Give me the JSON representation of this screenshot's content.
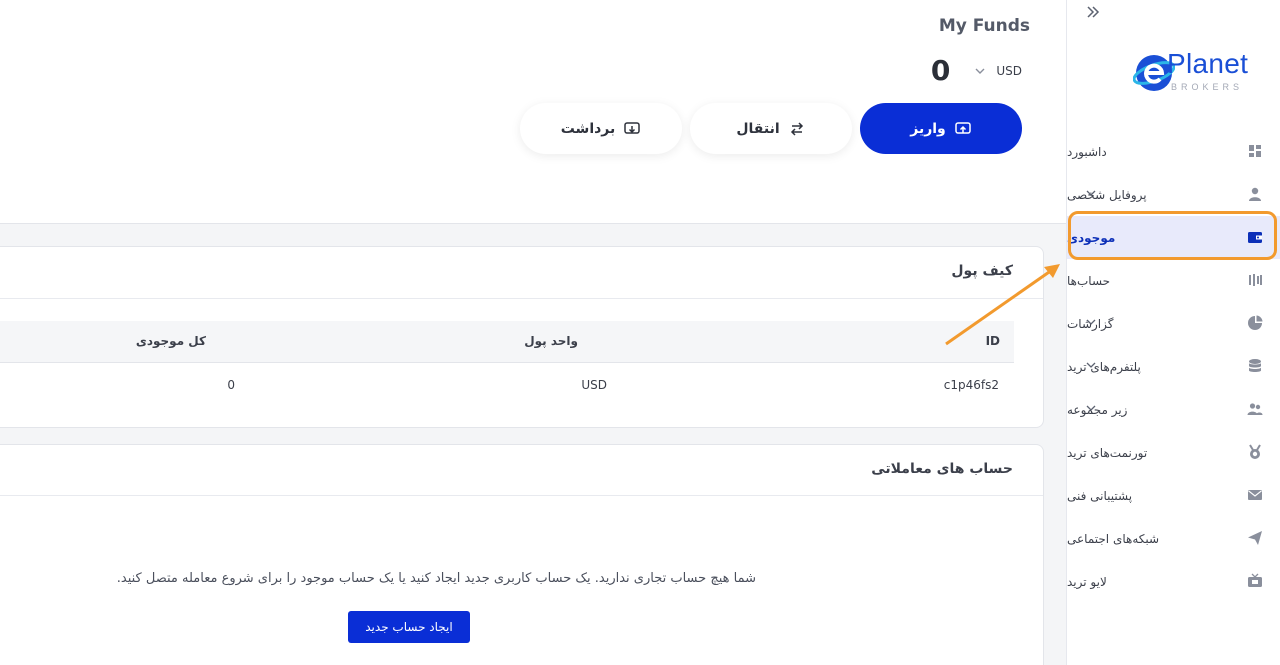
{
  "header": {
    "title": "My Funds",
    "amount": "0",
    "currency": "USD",
    "actions": {
      "deposit": "واریز",
      "transfer": "انتقال",
      "withdraw": "برداشت"
    }
  },
  "logo": {
    "name": "Planet",
    "sub": "BROKERS"
  },
  "sidebar": {
    "items": [
      {
        "label": "داشبورد",
        "icon": "dashboard-icon",
        "chevron": false,
        "active": false
      },
      {
        "label": "پروفایل شخصی",
        "icon": "user-icon",
        "chevron": true,
        "active": false
      },
      {
        "label": "موجودی",
        "icon": "wallet-icon",
        "chevron": false,
        "active": true
      },
      {
        "label": "حساب‌ها",
        "icon": "accounts-icon",
        "chevron": false,
        "active": false
      },
      {
        "label": "گزارشات",
        "icon": "pie-chart-icon",
        "chevron": true,
        "active": false
      },
      {
        "label": "پلتفرم‌های ترید",
        "icon": "database-icon",
        "chevron": true,
        "active": false
      },
      {
        "label": "زیر مجموعه",
        "icon": "users-icon",
        "chevron": true,
        "active": false
      },
      {
        "label": "تورنمت‌های ترید",
        "icon": "medal-icon",
        "chevron": false,
        "active": false
      },
      {
        "label": "پشتیبانی فنی",
        "icon": "mail-icon",
        "chevron": false,
        "active": false
      },
      {
        "label": "شبکه‌های اجتماعی",
        "icon": "send-icon",
        "chevron": false,
        "active": false
      },
      {
        "label": "لایو ترید",
        "icon": "tv-icon",
        "chevron": false,
        "active": false
      }
    ]
  },
  "wallet": {
    "title": "کیف پول",
    "columns": {
      "id": "ID",
      "unit": "واحد پول",
      "total": "کل موجودی"
    },
    "rows": [
      {
        "id": "c1p46fs2",
        "unit": "USD",
        "total": "0"
      }
    ]
  },
  "trading": {
    "title": "حساب های معاملاتی",
    "empty_message": "شما هیچ حساب تجاری ندارید. یک حساب کاربری جدید ایجاد کنید یا یک حساب موجود را برای شروع معامله متصل کنید.",
    "create_button": "ایجاد حساب جدید"
  },
  "colors": {
    "primary": "#0a2ed6",
    "highlight": "#f29a2e",
    "active_bg": "#e8eafb"
  }
}
